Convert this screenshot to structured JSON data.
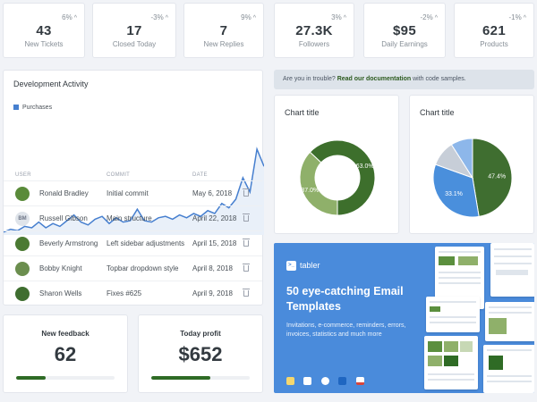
{
  "stats": [
    {
      "delta": "6%",
      "value": "43",
      "label": "New Tickets"
    },
    {
      "delta": "-3%",
      "value": "17",
      "label": "Closed Today"
    },
    {
      "delta": "9%",
      "value": "7",
      "label": "New Replies"
    },
    {
      "delta": "3%",
      "value": "27.3K",
      "label": "Followers"
    },
    {
      "delta": "-2%",
      "value": "$95",
      "label": "Daily Earnings"
    },
    {
      "delta": "-1%",
      "value": "621",
      "label": "Products"
    }
  ],
  "dev_activity": {
    "title": "Development Activity",
    "legend": "Purchases",
    "columns": {
      "user": "USER",
      "commit": "COMMIT",
      "date": "DATE"
    },
    "rows": [
      {
        "user": "Ronald Bradley",
        "initials": "",
        "commit": "Initial commit",
        "date": "May 6, 2018"
      },
      {
        "user": "Russell Gibson",
        "initials": "BM",
        "commit": "Main structure",
        "date": "April 22, 2018"
      },
      {
        "user": "Beverly Armstrong",
        "initials": "",
        "commit": "Left sidebar adjustments",
        "date": "April 15, 2018"
      },
      {
        "user": "Bobby Knight",
        "initials": "",
        "commit": "Topbar dropdown style",
        "date": "April 8, 2018"
      },
      {
        "user": "Sharon Wells",
        "initials": "",
        "commit": "Fixes #625",
        "date": "April 9, 2018"
      }
    ]
  },
  "alert": {
    "prefix": "Are you in trouble?",
    "link": "Read our documentation",
    "suffix": "with code samples."
  },
  "feedback": {
    "label": "New feedback",
    "value": "62",
    "progress": 0.3
  },
  "profit": {
    "label": "Today profit",
    "value": "$652",
    "progress": 0.6
  },
  "promo": {
    "brand": "tabler",
    "headline": "50 eye-catching Email Templates",
    "description": "Invitations, e-commerce, reminders, errors, invoices, statistics and much more"
  },
  "chart_data": [
    {
      "type": "area",
      "title": "Development Activity",
      "series": [
        {
          "name": "Purchases",
          "color": "#467fcf",
          "values": [
            2,
            4,
            3,
            6,
            5,
            9,
            5,
            8,
            6,
            10,
            14,
            9,
            7,
            11,
            13,
            8,
            12,
            9,
            10,
            18,
            10,
            9,
            12,
            13,
            11,
            14,
            12,
            15,
            13,
            17,
            15,
            22,
            19,
            25,
            40,
            30,
            60,
            48
          ]
        }
      ]
    },
    {
      "type": "pie",
      "donut": true,
      "title": "Chart title",
      "slices": [
        {
          "label": "37.0%",
          "value": 37.0,
          "color": "#8fb06a"
        },
        {
          "label": "63.0%",
          "value": 63.0,
          "color": "#3d6f2c"
        }
      ]
    },
    {
      "type": "pie",
      "donut": false,
      "title": "Chart title",
      "slices": [
        {
          "label": "47.4%",
          "value": 47.4,
          "color": "#3f6e30"
        },
        {
          "label": "33.1%",
          "value": 33.1,
          "color": "#4a8fdc"
        },
        {
          "label": "",
          "value": 10.5,
          "color": "#c7ced8"
        },
        {
          "label": "",
          "value": 9.0,
          "color": "#8db7ea"
        }
      ]
    }
  ]
}
